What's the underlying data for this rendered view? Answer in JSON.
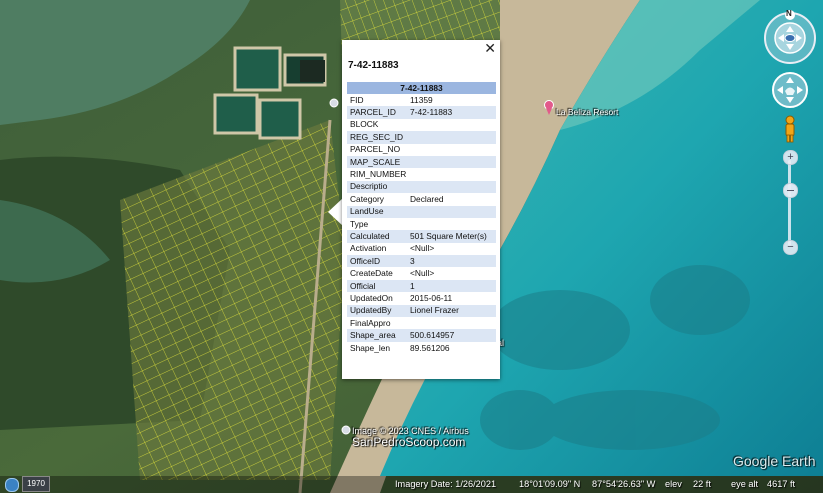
{
  "popup": {
    "title": "7-42-11883",
    "table_header": "7-42-11883",
    "close_label": "✕",
    "rows": [
      {
        "field": "FID",
        "value": "11359"
      },
      {
        "field": "PARCEL_ID",
        "value": "7-42-11883"
      },
      {
        "field": "BLOCK",
        "value": ""
      },
      {
        "field": "REG_SEC_ID",
        "value": ""
      },
      {
        "field": "PARCEL_NO",
        "value": ""
      },
      {
        "field": "MAP_SCALE",
        "value": ""
      },
      {
        "field": "RIM_NUMBER",
        "value": ""
      },
      {
        "field": "Descriptio",
        "value": ""
      },
      {
        "field": "Category",
        "value": "Declared"
      },
      {
        "field": "LandUse",
        "value": ""
      },
      {
        "field": "Type",
        "value": ""
      },
      {
        "field": "Calculated",
        "value": "501 Square Meter(s)"
      },
      {
        "field": "Activation",
        "value": "<Null>"
      },
      {
        "field": "OfficeID",
        "value": "3"
      },
      {
        "field": "CreateDate",
        "value": "<Null>"
      },
      {
        "field": "Official",
        "value": "1"
      },
      {
        "field": "UpdatedOn",
        "value": "2015-06-11"
      },
      {
        "field": "UpdatedBy",
        "value": "Lionel Frazer"
      },
      {
        "field": "FinalAppro",
        "value": ""
      },
      {
        "field": "Shape_area",
        "value": "500.614957"
      },
      {
        "field": "Shape_len",
        "value": "89.561206"
      }
    ]
  },
  "map": {
    "place_label": "La Beliza Resort",
    "attribution": "Image © 2023 CNES / Airbus",
    "watermark": "SanPedroScoop.com",
    "partial_label": "al",
    "brand": "Google Earth"
  },
  "status_bar": {
    "year_badge": "1970",
    "imagery_date": "Imagery Date: 1/26/2021",
    "latitude": "18°01'09.09\" N",
    "longitude": "87°54'26.63\" W",
    "elev_label": "elev",
    "elev_value": "22 ft",
    "eye_alt_label": "eye alt",
    "eye_alt_value": "4617 ft"
  },
  "controls": {
    "compass_north": "N",
    "zoom_in": "+",
    "zoom_out": "−",
    "zoom_level": 0.3
  },
  "colors": {
    "parcel_lines": "#e8e83a",
    "sea": "#2aa5a5",
    "table_header": "#9bb6e0",
    "table_stripe": "#dce6f4"
  }
}
